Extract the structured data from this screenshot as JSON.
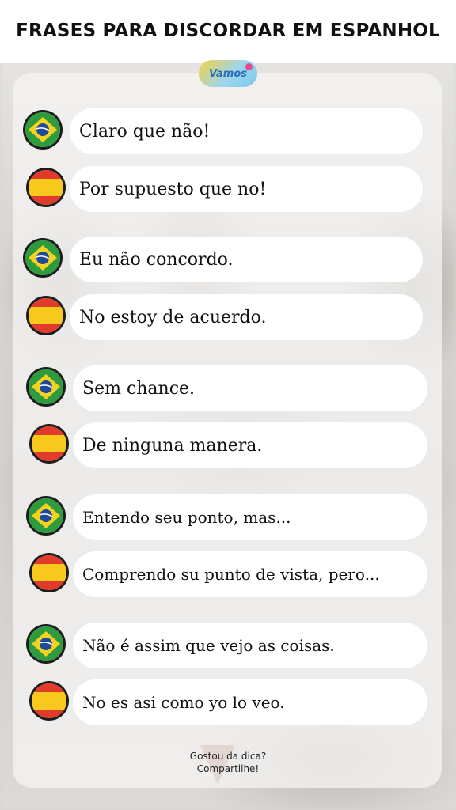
{
  "title": "FRASES PARA DISCORDAR EM ESPANHOL",
  "logo": {
    "text": "Vamos",
    "brand_colors": [
      "#f4d23b",
      "#7cc7ea",
      "#e24d8f"
    ]
  },
  "flag_icons": {
    "pt": "brazil-flag-icon",
    "es": "spain-flag-icon"
  },
  "phrases": [
    {
      "lang": "pt",
      "text": "Claro que não!"
    },
    {
      "lang": "es",
      "text": "Por supuesto que no!"
    },
    {
      "lang": "pt",
      "text": "Eu não concordo."
    },
    {
      "lang": "es",
      "text": "No estoy de acuerdo."
    },
    {
      "lang": "pt",
      "text": "Sem chance."
    },
    {
      "lang": "es",
      "text": "De ninguna manera."
    },
    {
      "lang": "pt",
      "text": "Entendo seu ponto, mas..."
    },
    {
      "lang": "es",
      "text": "Comprendo su punto de vista, pero..."
    },
    {
      "lang": "pt",
      "text": "Não é assim que vejo as coisas."
    },
    {
      "lang": "es",
      "text": "No es asi como yo lo veo."
    }
  ],
  "footer": {
    "line1": "Gostou da dica?",
    "line2": "Compartilhe!"
  }
}
